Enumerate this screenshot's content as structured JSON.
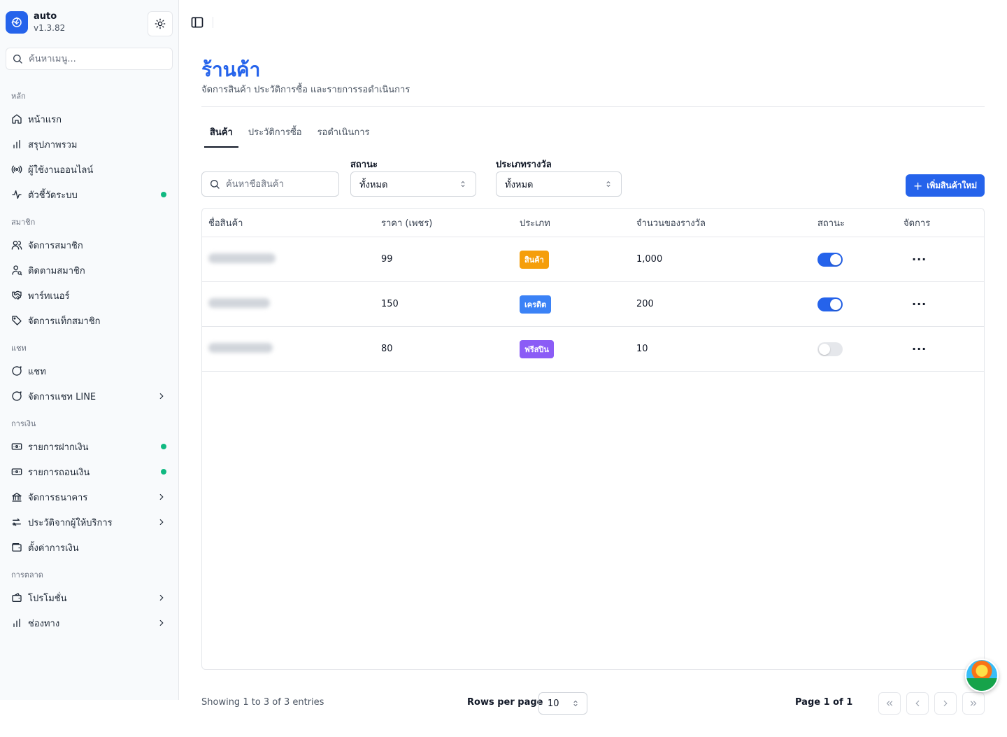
{
  "app": {
    "name": "auto",
    "version": "v1.3.82"
  },
  "sidebar": {
    "search_placeholder": "ค้นหาเมนู...",
    "sections": [
      {
        "label": "หลัก",
        "items": [
          {
            "label": "หน้าแรก",
            "icon": "home-icon"
          },
          {
            "label": "สรุปภาพรวม",
            "icon": "bar-chart-icon"
          },
          {
            "label": "ผู้ใช้งานออนไลน์",
            "icon": "radio-icon"
          },
          {
            "label": "ตัวชี้วัดระบบ",
            "icon": "activity-icon",
            "status_dot": true
          }
        ]
      },
      {
        "label": "สมาชิก",
        "items": [
          {
            "label": "จัดการสมาชิก",
            "icon": "users-icon"
          },
          {
            "label": "ติดตามสมาชิก",
            "icon": "user-search-icon"
          },
          {
            "label": "พาร์ทเนอร์",
            "icon": "handshake-icon"
          },
          {
            "label": "จัดการแท็กสมาชิก",
            "icon": "tag-icon"
          }
        ]
      },
      {
        "label": "แชท",
        "items": [
          {
            "label": "แชท",
            "icon": "chat-icon"
          },
          {
            "label": "จัดการแชท LINE",
            "icon": "chat-icon",
            "has_submenu": true
          }
        ]
      },
      {
        "label": "การเงิน",
        "items": [
          {
            "label": "รายการฝากเงิน",
            "icon": "money-in-icon",
            "status_dot": true
          },
          {
            "label": "รายการถอนเงิน",
            "icon": "money-out-icon",
            "status_dot": true
          },
          {
            "label": "จัดการธนาคาร",
            "icon": "bank-icon",
            "has_submenu": true
          },
          {
            "label": "ประวัติจากผู้ให้บริการ",
            "icon": "exchange-icon",
            "has_submenu": true
          },
          {
            "label": "ตั้งค่าการเงิน",
            "icon": "wallet-icon"
          }
        ]
      },
      {
        "label": "การตลาด",
        "items": [
          {
            "label": "โปรโมชั่น",
            "icon": "wallet-icon",
            "has_submenu": true
          },
          {
            "label": "ช่องทาง",
            "icon": "bar-chart-icon",
            "has_submenu": true
          }
        ]
      }
    ]
  },
  "page": {
    "title": "ร้านค้า",
    "subtitle": "จัดการสินค้า ประวัติการซื้อ และรายการรอดำเนินการ",
    "tabs": [
      {
        "label": "สินค้า",
        "active": true
      },
      {
        "label": "ประวัติการซื้อ",
        "active": false
      },
      {
        "label": "รอดำเนินการ",
        "active": false
      }
    ]
  },
  "filters": {
    "search_placeholder": "ค้นหาชื่อสินค้า",
    "status_label": "สถานะ",
    "status_value": "ทั้งหมด",
    "reward_type_label": "ประเภทรางวัล",
    "reward_type_value": "ทั้งหมด",
    "add_button": "เพิ่มสินค้าใหม่"
  },
  "table": {
    "headers": [
      "ชื่อสินค้า",
      "ราคา (เพชร)",
      "ประเภท",
      "จำนวนของรางวัล",
      "สถานะ",
      "จัดการ"
    ],
    "rows": [
      {
        "price": "99",
        "type": "สินค้า",
        "type_color": "#f59e0b",
        "quantity": "1,000",
        "enabled": true
      },
      {
        "price": "150",
        "type": "เครดิต",
        "type_color": "#3b82f6",
        "quantity": "200",
        "enabled": true
      },
      {
        "price": "80",
        "type": "ฟรีสปิน",
        "type_color": "#8b5cf6",
        "quantity": "10",
        "enabled": false
      }
    ]
  },
  "pagination": {
    "showing": "Showing 1 to 3 of 3 entries",
    "rows_per_page_label": "Rows per page",
    "rows_per_page_value": "10",
    "page_label": "Page 1 of 1"
  },
  "colors": {
    "primary": "#2563eb",
    "status_dot": "#10b981"
  }
}
